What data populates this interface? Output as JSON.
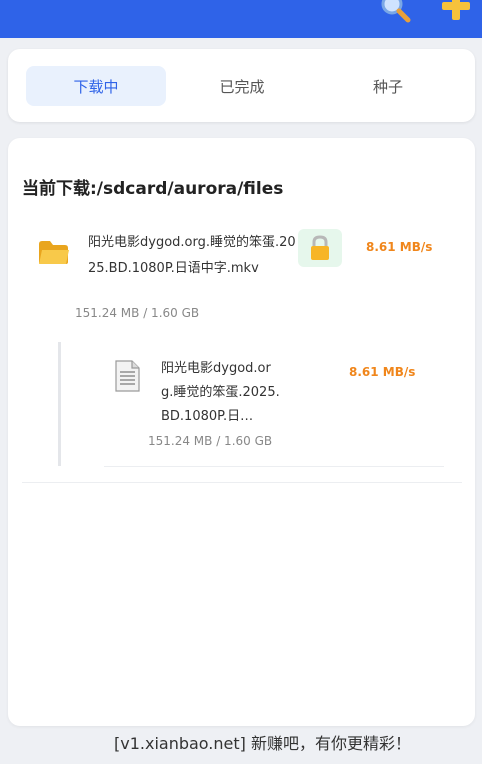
{
  "tabs": [
    {
      "label": "下载中",
      "active": true
    },
    {
      "label": "已完成",
      "active": false
    },
    {
      "label": "种子",
      "active": false
    }
  ],
  "current_download": {
    "title": "当前下载:/sdcard/aurora/files"
  },
  "items": [
    {
      "name": "阳光电影dygod.org.睡觉的笨蛋.2025.BD.1080P.日语中字.mkv",
      "size": "151.24 MB / 1.60 GB",
      "speed": "8.61 MB/s",
      "icon": "folder-icon"
    },
    {
      "name": "阳光电影dygod.org.睡觉的笨蛋.2025.BD.1080P.日…",
      "size": "151.24 MB / 1.60 GB",
      "speed": "8.61 MB/s",
      "icon": "document-icon"
    }
  ],
  "watermark": "[v1.xianbao.net] 新赚吧，有你更精彩！",
  "colors": {
    "topbar": "#2f63e8",
    "active_tab_bg": "#e9f1fd",
    "speed": "#f0861b",
    "lock_bg": "#e6f7ec"
  }
}
